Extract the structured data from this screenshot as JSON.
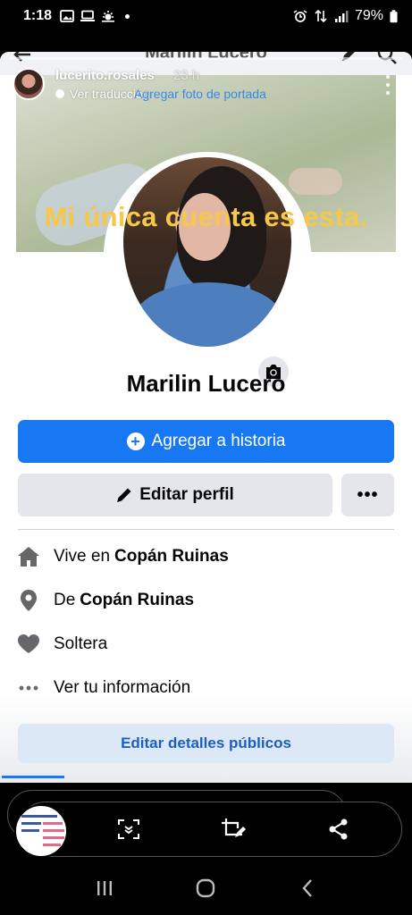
{
  "status_bar": {
    "time": "1:18",
    "battery": "79%"
  },
  "story": {
    "username": "lucerito.rosales",
    "time_ago": "23 h",
    "translate_label": "Ver traducción",
    "overlay_text": "Mi única cuenta es esta."
  },
  "profile": {
    "header_title": "Marilin Lucero",
    "cover_photo_link": "Agregar foto de portada",
    "name": "Marilin Lucero",
    "add_story_label": "Agregar a historia",
    "edit_profile_label": "Editar perfil",
    "more_label": "•••",
    "info": [
      {
        "prefix": "Vive en",
        "value": "Copán Ruinas",
        "icon": "home-icon"
      },
      {
        "prefix": "De",
        "value": "Copán Ruinas",
        "icon": "location-pin-icon"
      },
      {
        "prefix": "Soltera",
        "value": "",
        "icon": "heart-icon"
      },
      {
        "prefix": "Ver tu información",
        "value": "",
        "icon": "more-dots-icon"
      }
    ],
    "edit_public_details_label": "Editar detalles públicos"
  },
  "colors": {
    "facebook_blue": "#1877f2",
    "overlay_text": "#f5c84a",
    "button_gray": "#e4e6eb"
  }
}
